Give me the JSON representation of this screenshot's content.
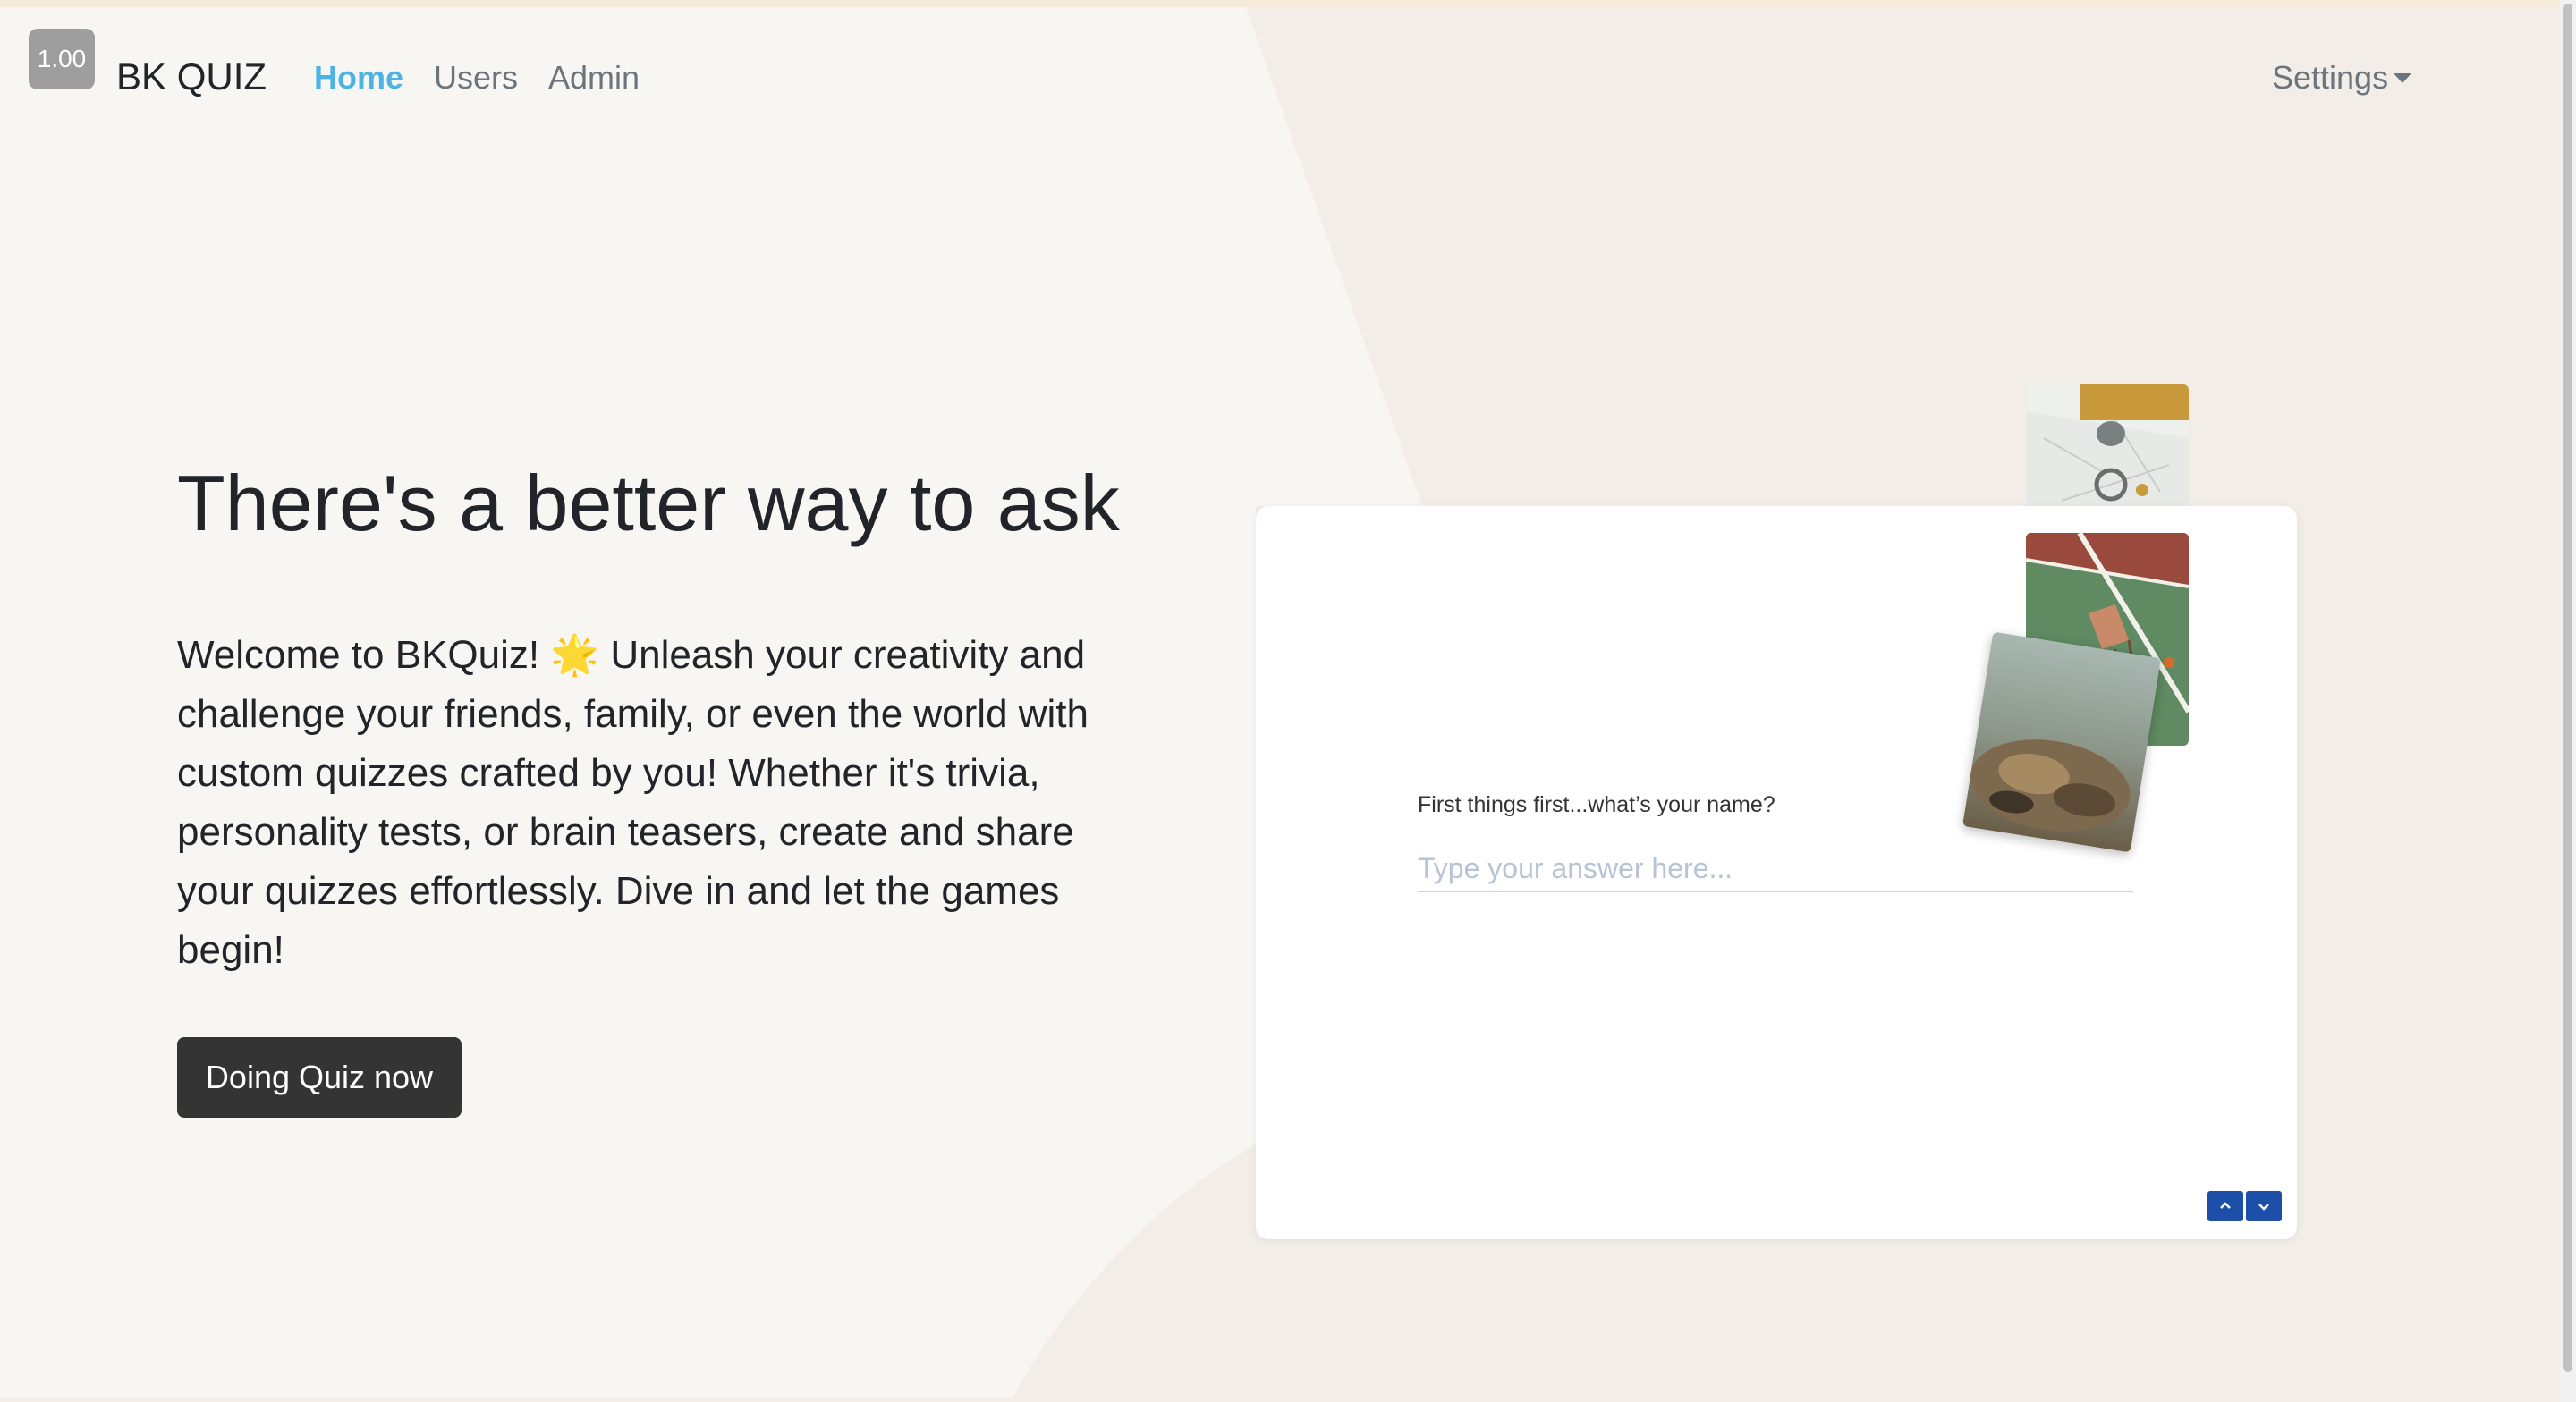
{
  "navbar": {
    "version_badge": "1.00",
    "brand": "BK QUIZ",
    "links": [
      {
        "label": "Home"
      },
      {
        "label": "Users"
      },
      {
        "label": "Admin"
      }
    ],
    "settings_label": "Settings"
  },
  "hero": {
    "title": "There's a better way to ask",
    "description": "Welcome to BKQuiz! 🌟 Unleash your creativity and challenge your friends, family, or even the world with custom quizzes crafted by you! Whether it's trivia, personality tests, or brain teasers, create and share your quizzes effortlessly. Dive in and let the games begin!",
    "cta_label": "Doing Quiz now"
  },
  "preview": {
    "question": "First things first...what’s your name?",
    "answer_placeholder": "Type your answer here...",
    "accent_color": "#1e4fa8"
  },
  "colors": {
    "background": "#f8f6f3",
    "shape": "#f2ede7",
    "active_link": "#4db3e2",
    "button": "#343434"
  }
}
